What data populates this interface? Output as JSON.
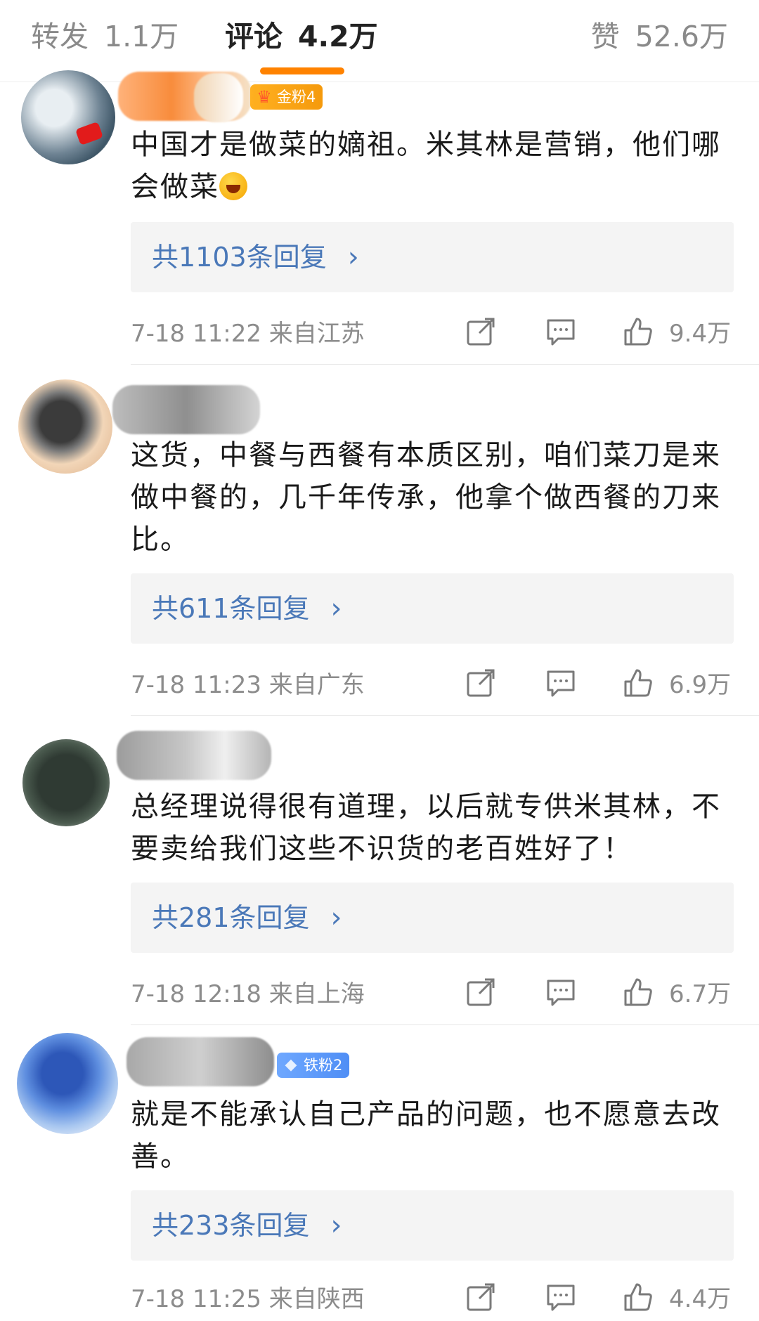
{
  "tabs": {
    "repost": {
      "label": "转发",
      "count": "1.1万"
    },
    "comments": {
      "label": "评论",
      "count": "4.2万"
    },
    "likes": {
      "label": "赞",
      "count": "52.6万"
    }
  },
  "accent_color": "#ff8200",
  "link_color": "#4a78b8",
  "comments": [
    {
      "badge": {
        "text": "金粉4",
        "icon": "crown-icon"
      },
      "text": "中国才是做菜的嫡祖。米其林是营销，他们哪会做菜",
      "emoji": "laughing-emoji",
      "replies": "共1103条回复",
      "time": "7-18  11:22",
      "location": "来自江苏",
      "likes": "9.4万"
    },
    {
      "text": "这货，中餐与西餐有本质区别，咱们菜刀是来做中餐的，几千年传承，他拿个做西餐的刀来比。",
      "replies": "共611条回复",
      "time": "7-18  11:23",
      "location": "来自广东",
      "likes": "6.9万"
    },
    {
      "text": "总经理说得很有道理，以后就专供米其林，不要卖给我们这些不识货的老百姓好了！",
      "replies": "共281条回复",
      "time": "7-18  12:18",
      "location": "来自上海",
      "likes": "6.7万"
    },
    {
      "badge": {
        "text": "铁粉2",
        "icon": "diamond-icon"
      },
      "text": "就是不能承认自己产品的问题，也不愿意去改善。",
      "replies": "共233条回复",
      "time": "7-18  11:25",
      "location": "来自陕西",
      "likes": "4.4万"
    }
  ],
  "icons": {
    "share": "share-icon",
    "comment": "comment-icon",
    "like": "thumbs-up-icon",
    "chevron": "chevron-right-icon"
  }
}
